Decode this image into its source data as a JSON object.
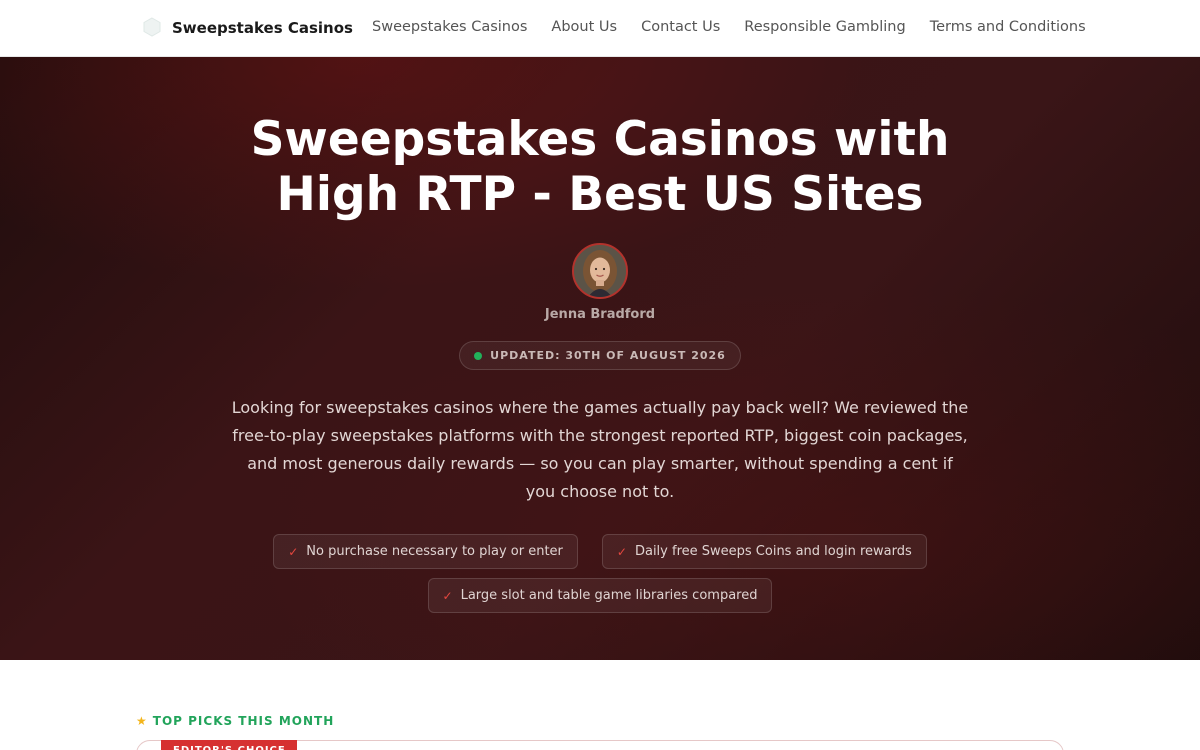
{
  "nav": {
    "brand": "Sweepstakes Casinos",
    "links": [
      "Sweepstakes Casinos",
      "About Us",
      "Contact Us",
      "Responsible Gambling",
      "Terms and Conditions"
    ]
  },
  "hero": {
    "title": "Sweepstakes Casinos with High RTP - Best US Sites",
    "author": "Jenna Bradford",
    "updated": "UPDATED: 30TH OF AUGUST 2026",
    "intro": "Looking for sweepstakes casinos where the games actually pay back well? We reviewed the free-to-play sweepstakes platforms with the strongest reported RTP, biggest coin packages, and most generous daily rewards — so you can play smarter, without spending a cent if you choose not to.",
    "features": [
      "No purchase necessary to play or enter",
      "Daily free Sweeps Coins and login rewards",
      "Large slot and table game libraries compared"
    ]
  },
  "picks": {
    "label": "TOP PICKS THIS MONTH",
    "badge": "EDITOR'S CHOICE"
  },
  "colors": {
    "accent": "#d63131",
    "green": "#22a45b",
    "hero_bg": "#3b1416"
  }
}
